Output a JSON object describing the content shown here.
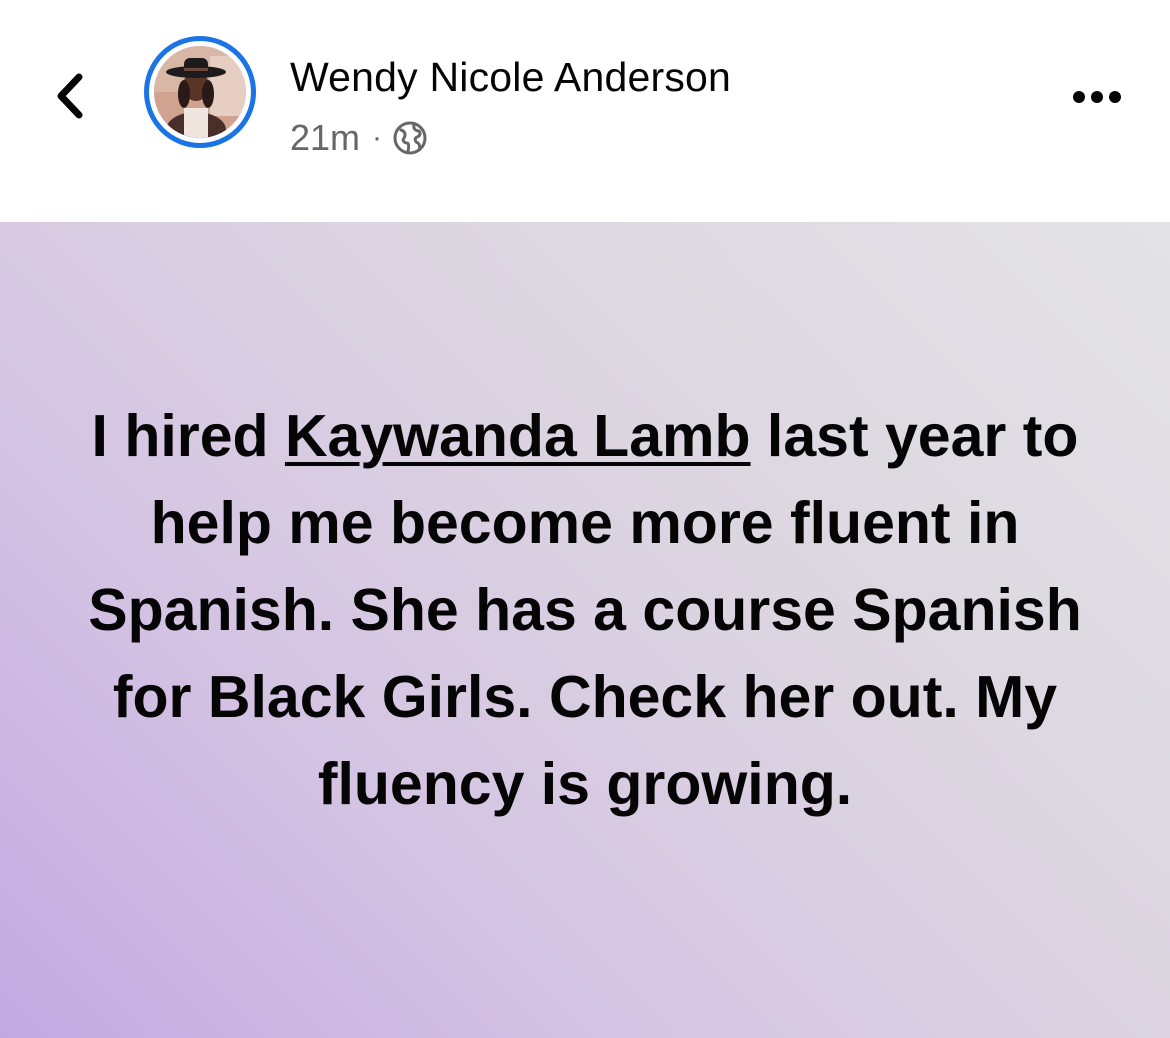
{
  "post": {
    "author": "Wendy Nicole Anderson",
    "time": "21m",
    "separator": "·",
    "audience_icon": "globe-icon",
    "content": {
      "before": "I hired ",
      "mention": "Kaywanda Lamb",
      "after": " last year to help me become more fluent in Spanish. She has a course Spanish for Black Girls. Check her out. My fluency is growing."
    }
  },
  "colors": {
    "story_ring": "#1b74e4",
    "text_primary": "#050505",
    "text_secondary": "#65676b",
    "background_gradient_start": "#c3a9e2",
    "background_gradient_end": "#e3e3e5"
  },
  "icons": {
    "back": "chevron-left-icon",
    "more": "more-options-icon"
  }
}
